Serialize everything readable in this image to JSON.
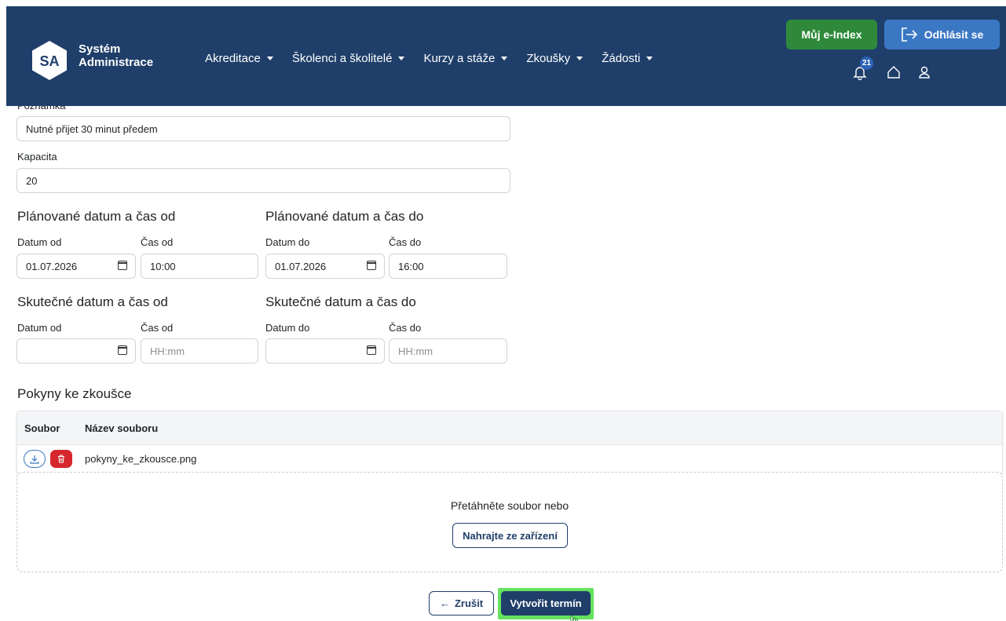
{
  "header": {
    "logo_badge": "SA",
    "logo_line1": "Systém",
    "logo_line2": "Administrace",
    "nav": [
      {
        "label": "Akreditace"
      },
      {
        "label": "Školenci a školitelé"
      },
      {
        "label": "Kurzy a stáže"
      },
      {
        "label": "Zkoušky"
      },
      {
        "label": "Žádosti"
      }
    ],
    "eindex_label": "Můj e-Index",
    "logout_label": "Odhlásit se",
    "notification_count": "21",
    "colors": {
      "header_bg": "#1f3f6a",
      "eindex_bg": "#2e8a3a",
      "logout_bg": "#3b78c4"
    },
    "icons": [
      "bell-icon",
      "home-icon",
      "user-icon",
      "logout-icon"
    ]
  },
  "form": {
    "note_label": "Poznámka",
    "note_value": "Nutné přijet 30 minut předem",
    "capacity_label": "Kapacita",
    "capacity_value": "20",
    "planned_from": {
      "heading": "Plánované datum a čas od",
      "date_label": "Datum od",
      "time_label": "Čas od",
      "date_value": "01.07.2026",
      "time_value": "10:00"
    },
    "planned_to": {
      "heading": "Plánované datum a čas do",
      "date_label": "Datum do",
      "time_label": "Čas do",
      "date_value": "01.07.2026",
      "time_value": "16:00"
    },
    "actual_from": {
      "heading": "Skutečné datum a čas od",
      "date_label": "Datum od",
      "time_label": "Čas od",
      "time_placeholder": "HH:mm"
    },
    "actual_to": {
      "heading": "Skutečné datum a čas do",
      "date_label": "Datum do",
      "time_label": "Čas do",
      "time_placeholder": "HH:mm"
    }
  },
  "files": {
    "heading": "Pokyny ke zkoušce",
    "columns": [
      "Soubor",
      "Název souboru"
    ],
    "rows": [
      {
        "name": "pokyny_ke_zkousce.png"
      }
    ],
    "dropzone_text": "Přetáhněte soubor nebo",
    "upload_label": "Nahrajte ze zařízení"
  },
  "actions": {
    "cancel_label": "Zrušit",
    "cancel_arrow": "←",
    "create_label": "Vytvořit termín",
    "highlight_color": "#64e25e"
  }
}
